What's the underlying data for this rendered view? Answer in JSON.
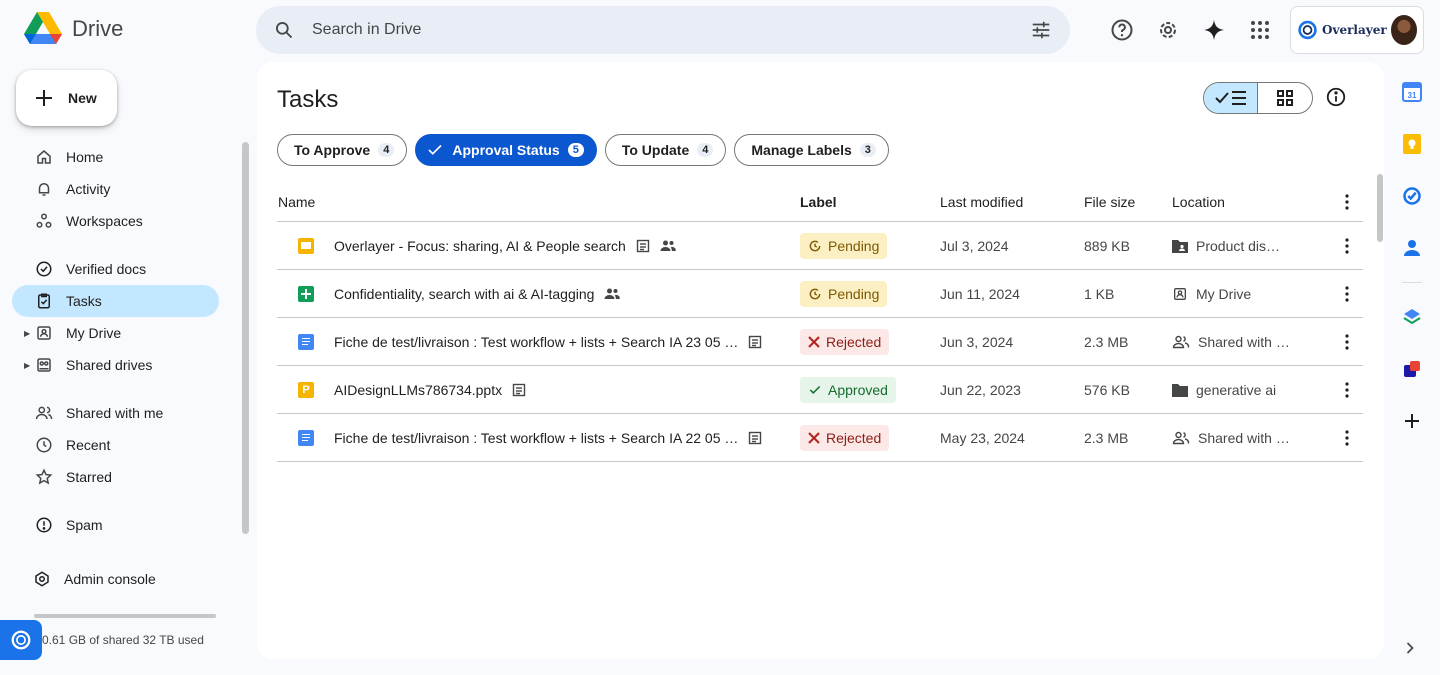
{
  "app": {
    "name": "Drive"
  },
  "search": {
    "placeholder": "Search in Drive"
  },
  "account": {
    "name": "Overlayer"
  },
  "sidebar": {
    "new_label": "New",
    "items": [
      {
        "label": "Home"
      },
      {
        "label": "Activity"
      },
      {
        "label": "Workspaces"
      },
      {
        "label": "Verified docs"
      },
      {
        "label": "Tasks"
      },
      {
        "label": "My Drive"
      },
      {
        "label": "Shared drives"
      },
      {
        "label": "Shared with me"
      },
      {
        "label": "Recent"
      },
      {
        "label": "Starred"
      },
      {
        "label": "Spam"
      },
      {
        "label": "Admin console"
      }
    ],
    "storage_text": "0.61 GB of shared 32 TB used"
  },
  "main": {
    "title": "Tasks",
    "chips": [
      {
        "label": "To Approve",
        "count": "4"
      },
      {
        "label": "Approval Status",
        "count": "5"
      },
      {
        "label": "To Update",
        "count": "4"
      },
      {
        "label": "Manage Labels",
        "count": "3"
      }
    ],
    "columns": {
      "name": "Name",
      "label": "Label",
      "modified": "Last modified",
      "size": "File size",
      "location": "Location"
    },
    "rows": [
      {
        "name": "Overlayer -  Focus: sharing, AI & People search",
        "label": "Pending",
        "modified": "Jul 3, 2024",
        "size": "889 KB",
        "location": "Product dis…"
      },
      {
        "name": "Confidentiality, search with ai & AI-tagging",
        "label": "Pending",
        "modified": "Jun 11, 2024",
        "size": "1 KB",
        "location": "My Drive"
      },
      {
        "name": "Fiche de test/livraison : Test workflow + lists + Search IA 23 05 …",
        "label": "Rejected",
        "modified": "Jun 3, 2024",
        "size": "2.3 MB",
        "location": "Shared with …"
      },
      {
        "name": "AIDesignLLMs786734.pptx",
        "label": "Approved",
        "modified": "Jun 22, 2023",
        "size": "576 KB",
        "location": "generative ai"
      },
      {
        "name": "Fiche de test/livraison : Test workflow + lists + Search IA 22 05 …",
        "label": "Rejected",
        "modified": "May 23, 2024",
        "size": "2.3 MB",
        "location": "Shared with …"
      }
    ]
  },
  "colors": {
    "accent": "#0b57d0",
    "active_nav": "#c2e7ff",
    "slides": "#f4b400",
    "sheets": "#0f9d58",
    "docs": "#4285f4"
  }
}
